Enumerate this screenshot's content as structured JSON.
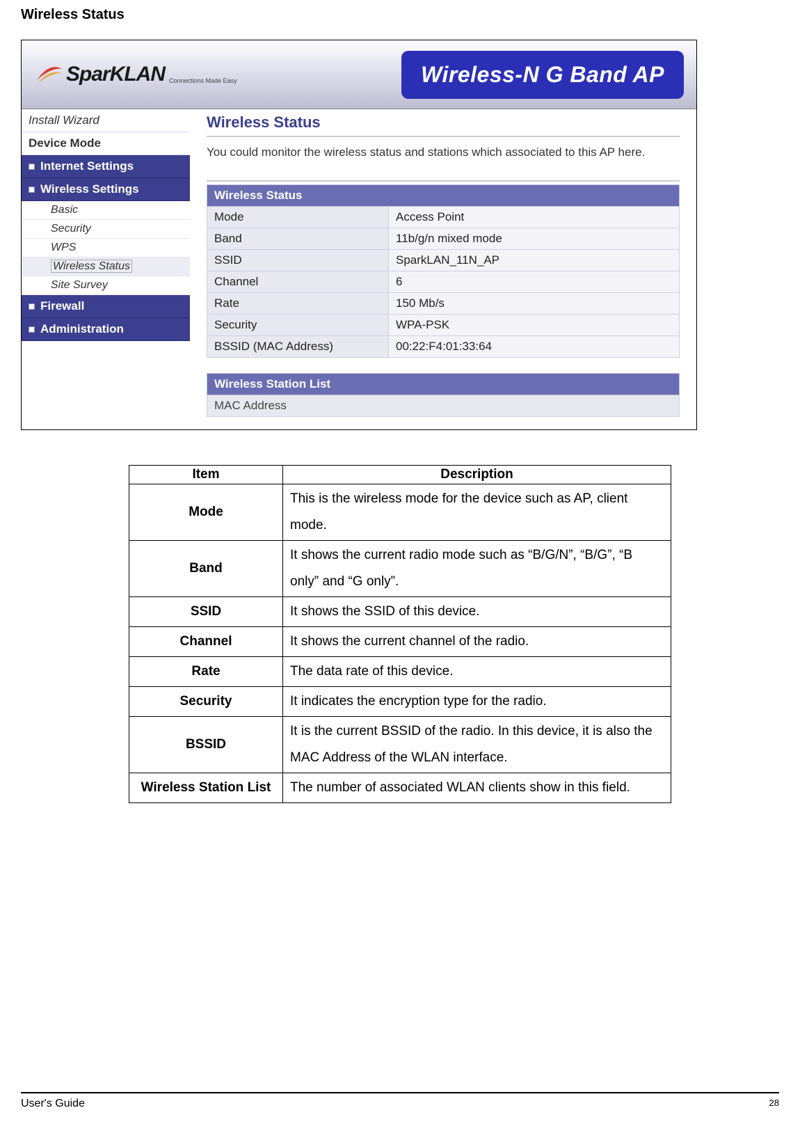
{
  "section_title": "Wireless Status",
  "banner": {
    "logo_text": "SparKLAN",
    "logo_tagline": "Connections Made Easy",
    "headline": "Wireless-N G Band AP"
  },
  "sidebar": {
    "install_wizard": "Install Wizard",
    "device_mode": "Device Mode",
    "internet_settings": "Internet Settings",
    "wireless_settings": "Wireless Settings",
    "subs": {
      "basic": "Basic",
      "security": "Security",
      "wps": "WPS",
      "wireless_status": "Wireless Status",
      "site_survey": "Site Survey"
    },
    "firewall": "Firewall",
    "administration": "Administration"
  },
  "main": {
    "title": "Wireless Status",
    "desc": "You could monitor the wireless status and stations which associated to this AP here.",
    "status_header": "Wireless Status",
    "rows": {
      "mode_l": "Mode",
      "mode_v": "Access Point",
      "band_l": "Band",
      "band_v": "11b/g/n mixed mode",
      "ssid_l": "SSID",
      "ssid_v": "SparkLAN_11N_AP",
      "channel_l": "Channel",
      "channel_v": "6",
      "rate_l": "Rate",
      "rate_v": "150 Mb/s",
      "security_l": "Security",
      "security_v": "WPA-PSK",
      "bssid_l": "BSSID (MAC Address)",
      "bssid_v": "00:22:F4:01:33:64"
    },
    "station_header": "Wireless Station List",
    "station_col": "MAC Address"
  },
  "desc_table": {
    "hdr_item": "Item",
    "hdr_desc": "Description",
    "rows": [
      {
        "item": "Mode",
        "desc": "This is the wireless mode for the device such as AP, client mode."
      },
      {
        "item": "Band",
        "desc": "It shows the current radio mode such as “B/G/N”, “B/G”, “B only” and “G only”."
      },
      {
        "item": "SSID",
        "desc": "It shows the SSID of this device."
      },
      {
        "item": "Channel",
        "desc": "It shows the current channel of the radio."
      },
      {
        "item": "Rate",
        "desc": "The data rate of this device."
      },
      {
        "item": "Security",
        "desc": "It indicates the encryption type for the radio."
      },
      {
        "item": "BSSID",
        "desc": "It is the current BSSID of the radio. In this device, it is also the MAC Address of the WLAN interface."
      },
      {
        "item": "Wireless Station List",
        "desc": "The number of associated WLAN clients show in this field."
      }
    ]
  },
  "footer": {
    "left": "User's Guide",
    "page": "28"
  }
}
